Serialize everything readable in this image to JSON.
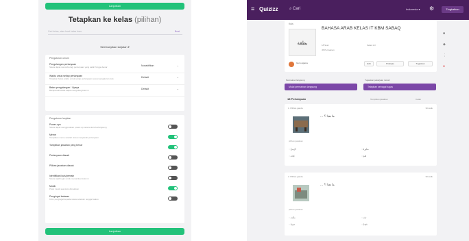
{
  "left_panel": {
    "save_button_top": "Lanjutkan",
    "title_bold": "Tetapkan ke kelas",
    "title_thin": "(pilihan)",
    "search_placeholder": "Cari kelas, atau buat kelas baru",
    "search_link": "Buat",
    "advanced_label": "Sembunyikan lanjutan ▾",
    "scoring_header": "Pengaturan umum",
    "scoring_rows": [
      {
        "title": "Pengulangan pertanyaan",
        "desc": "Siswa dapat mencoba lagi pertanyaan yang salah hingga benar",
        "value": "Nonaktifkan"
      },
      {
        "title": "Waktu untuk setiap pertanyaan",
        "desc": "Tetapkan batas waktu untuk setiap pertanyaan sesuai pengaturan kuis",
        "value": "Default"
      },
      {
        "title": "Batas pengulangan / Upaya",
        "desc": "Berapa kali siswa dapat mengulang kuis ini",
        "value": "Default"
      }
    ],
    "toggles_header": "Pengaturan lanjutan",
    "toggle_rows": [
      {
        "title": "Power-ups",
        "desc": "Siswa dapat menggunakan power-up selama kuis berlangsung",
        "on": false
      },
      {
        "title": "Meme",
        "desc": "Tampilkan meme setelah siswa menjawab pertanyaan",
        "on": true
      },
      {
        "title": "Tampilkan jawaban yang benar",
        "desc": "",
        "on": true
      },
      {
        "title": "Pertanyaan diacak",
        "desc": "",
        "on": false
      },
      {
        "title": "Pilihan jawaban diacak",
        "desc": "",
        "on": false
      },
      {
        "title": "Identifikasi kuis/pemain",
        "desc": "Siswa wajib login untuk memainkan kuis ini",
        "on": false
      },
      {
        "title": "Musik",
        "desc": "Putar musik saat kuis dimainkan",
        "on": true
      },
      {
        "title": "Pengingat batasan",
        "desc": "Kirim pengingat kepada siswa sebelum tenggat waktu",
        "on": false
      }
    ],
    "save_button_bottom": "Lanjutkan"
  },
  "right_panel": {
    "brand": "Quizizz",
    "search": "Cari",
    "language": "Indonesia ▾",
    "upgrade": "Tingkatkan",
    "quiz": {
      "label": "Kuis",
      "thumb_text": "بطقة",
      "title": "BAHASA ARAB KELAS IT KBM SABAQ",
      "meta1": "18 Soal",
      "meta2": "Kelas 1-3",
      "meta3": "45 Permainan",
      "author": "Guru Agama",
      "btn1": "Edit",
      "btn2": "Pratinjau",
      "btn3": "Tugaskan"
    },
    "practice_label": "Permainan langsung",
    "practice_btn": "Mulai permainan langsung",
    "assign_label": "Tugaskan pekerjaan rumah",
    "assign_btn": "Tetapkan sebagai tugas",
    "questions_header": "18 Pertanyaan",
    "tools1": "Tampilkan jawaban",
    "tools2": "Cetak",
    "questions": [
      {
        "number": "1. Pilihan ganda",
        "points": "30 detik",
        "text": "... ما هذا ؟",
        "answers_label": "pilihan jawaban",
        "answers": [
          "كُرْسِيٌّ",
          "سَبُّورَةٌ",
          "كِتَابٌ",
          "قَلَمٌ"
        ]
      },
      {
        "number": "2. Pilihan ganda",
        "points": "30 detik",
        "text": "... ما هذا ؟",
        "answers_label": "pilihan jawaban",
        "answers": [
          "مَكْتَبٌ",
          "بَابٌ",
          "حَقِيبَةٌ",
          "نَافِذَةٌ"
        ]
      }
    ]
  },
  "colors": {
    "green": "#22c27a",
    "purple_bar": "#4a1f5e",
    "purple_button": "#7b47a7"
  }
}
